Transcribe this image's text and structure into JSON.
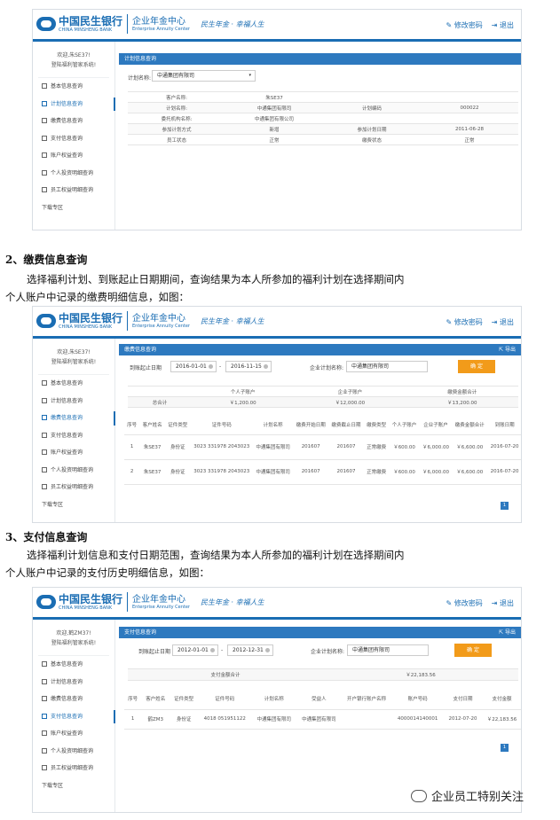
{
  "header": {
    "bank_cn": "中国民生银行",
    "bank_en": "CHINA MINSHENG BANK",
    "center_cn": "企业年金中心",
    "center_en": "Enterprise Annuity Center",
    "slogan": "民生年金 · 幸福人生",
    "change_password": "修改密码",
    "logout": "退出"
  },
  "shot1": {
    "welcome_line1": "欢迎,朱SE37!",
    "welcome_line2": "登陆福利管家系统!",
    "menu": [
      "基本信息查询",
      "计划信息查询",
      "缴费信息查询",
      "支付信息查询",
      "账户权益查询",
      "个人投资明细查询",
      "员工权益明细查询",
      "下载专区"
    ],
    "panel_title": "计划信息查询",
    "plan_label": "计划名称:",
    "plan_value": "中通集团有限司",
    "rows": [
      [
        "客户名称:",
        "朱SE37",
        "",
        ""
      ],
      [
        "计划名称:",
        "中通集团有限司",
        "计划编码",
        "000022"
      ],
      [
        "委托机构名称:",
        "中通集团有限公司",
        "",
        ""
      ],
      [
        "参加计划方式",
        "新增",
        "参加计划日期",
        "2011-06-28"
      ],
      [
        "员工状态",
        "正常",
        "缴费状态",
        "正常"
      ]
    ]
  },
  "section2": {
    "heading": "2、缴费信息查询",
    "para_line1": "选择福利计划、到账起止日期期间，查询结果为本人所参加的福利计划在选择期间内",
    "para_line2": "个人账户中记录的缴费明细信息，如图："
  },
  "shot2": {
    "welcome_line1": "欢迎,朱SE37!",
    "welcome_line2": "登陆福利管家系统!",
    "menu": [
      "基本信息查询",
      "计划信息查询",
      "缴费信息查询",
      "支付信息查询",
      "账户权益查询",
      "个人投资明细查询",
      "员工权益明细查询",
      "下载专区"
    ],
    "panel_title": "缴费信息查询",
    "export": "导出",
    "date_label": "到账起止日期",
    "date_from": "2016-01-01",
    "date_to": "2016-11-15",
    "dash": "-",
    "plan_label": "企业计划名称:",
    "plan_value": "中通集团有限司",
    "confirm": "确 定",
    "sum_headers": [
      "个人子账户",
      "企业子账户",
      "缴费金额合计"
    ],
    "sum_label": "总合计",
    "sum_values": [
      "￥1,200.00",
      "￥12,000.00",
      "￥13,200.00"
    ],
    "detail_headers": [
      "序号",
      "客户姓名",
      "证件类型",
      "证件号码",
      "计划名称",
      "缴费开始日期",
      "缴费截止日期",
      "缴费类型",
      "个人子账户",
      "企业子账户",
      "缴费金额合计",
      "到账日期"
    ],
    "detail_rows": [
      [
        "1",
        "朱SE37",
        "身份证",
        "3023 331978 2043023",
        "中通集团有限司",
        "201607",
        "201607",
        "正常缴费",
        "￥600.00",
        "￥6,000.00",
        "￥6,600.00",
        "2016-07-20"
      ],
      [
        "2",
        "朱SE37",
        "身份证",
        "3023 331978 2043023",
        "中通集团有限司",
        "201607",
        "201607",
        "正常缴费",
        "￥600.00",
        "￥6,000.00",
        "￥6,600.00",
        "2016-07-20"
      ]
    ],
    "page": "1"
  },
  "section3": {
    "heading": "3、支付信息查询",
    "para_line1": "选择福利计划信息和支付日期范围，查询结果为本人所参加的福利计划在选择期间内",
    "para_line2": "个人账户中记录的支付历史明细信息，如图："
  },
  "shot3": {
    "welcome_line1": "欢迎,鹤ZM37!",
    "welcome_line2": "登陆福利管家系统!",
    "menu": [
      "基本信息查询",
      "计划信息查询",
      "缴费信息查询",
      "支付信息查询",
      "账户权益查询",
      "个人投资明细查询",
      "员工权益明细查询",
      "下载专区"
    ],
    "panel_title": "支付信息查询",
    "export": "导出",
    "date_label": "到账起止日期",
    "date_from": "2012-01-01",
    "date_to": "2012-12-31",
    "dash": "-",
    "plan_label": "企业计划名称:",
    "plan_value": "中通集团有限司",
    "confirm": "确 定",
    "sum_label": "支付金额合计",
    "sum_value": "￥22,183.56",
    "detail_headers": [
      "序号",
      "客户姓名",
      "证件类型",
      "证件号码",
      "计划名称",
      "受益人",
      "开户银行账户名称",
      "账户号码",
      "支付日期",
      "支付金额"
    ],
    "detail_rows": [
      [
        "1",
        "鹤ZM3",
        "身份证",
        "4018 051951122",
        "中通集团有限司",
        "中通集团有限司",
        "",
        "4000014140001",
        "2012-07-20",
        "￥22,183.56"
      ]
    ],
    "page": "1"
  },
  "watermark": "企业员工特别关注"
}
